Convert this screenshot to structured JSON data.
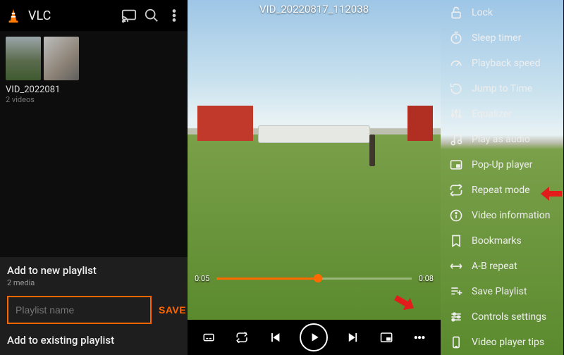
{
  "library": {
    "app_name": "VLC",
    "thumb_title": "VID_2022081",
    "thumb_sub": "2 videos"
  },
  "sheet": {
    "new_title": "Add to new playlist",
    "new_sub": "2 media",
    "input_placeholder": "Playlist name",
    "save_label": "SAVE",
    "existing_title": "Add to existing playlist"
  },
  "player": {
    "video_title": "VID_20220817_112038",
    "time_current": "0:05",
    "time_total": "0:08"
  },
  "options": {
    "items": [
      {
        "id": "lock",
        "label": "Lock"
      },
      {
        "id": "sleep",
        "label": "Sleep timer"
      },
      {
        "id": "speed",
        "label": "Playback speed"
      },
      {
        "id": "jump",
        "label": "Jump to Time"
      },
      {
        "id": "equalizer",
        "label": "Equalizer"
      },
      {
        "id": "playaudio",
        "label": "Play as audio"
      },
      {
        "id": "popup",
        "label": "Pop-Up player"
      },
      {
        "id": "repeat",
        "label": "Repeat mode"
      },
      {
        "id": "info",
        "label": "Video information"
      },
      {
        "id": "bookmarks",
        "label": "Bookmarks"
      },
      {
        "id": "abrepeat",
        "label": "A-B repeat"
      },
      {
        "id": "saveplaylist",
        "label": "Save Playlist"
      },
      {
        "id": "controls",
        "label": "Controls settings"
      },
      {
        "id": "tips",
        "label": "Video player tips"
      }
    ]
  },
  "colors": {
    "accent": "#ff6a00"
  }
}
